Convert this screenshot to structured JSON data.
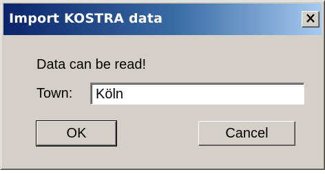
{
  "window": {
    "title": "Import KOSTRA data",
    "close_glyph": "✕",
    "close_icon": "close-icon"
  },
  "message": "Data can be read!",
  "town": {
    "label": "Town:",
    "value": "Köln"
  },
  "buttons": {
    "ok": "OK",
    "cancel": "Cancel"
  },
  "colors": {
    "titlebar_start": "#0a246a",
    "titlebar_end": "#a6caf0",
    "face": "#d4d0c8"
  }
}
